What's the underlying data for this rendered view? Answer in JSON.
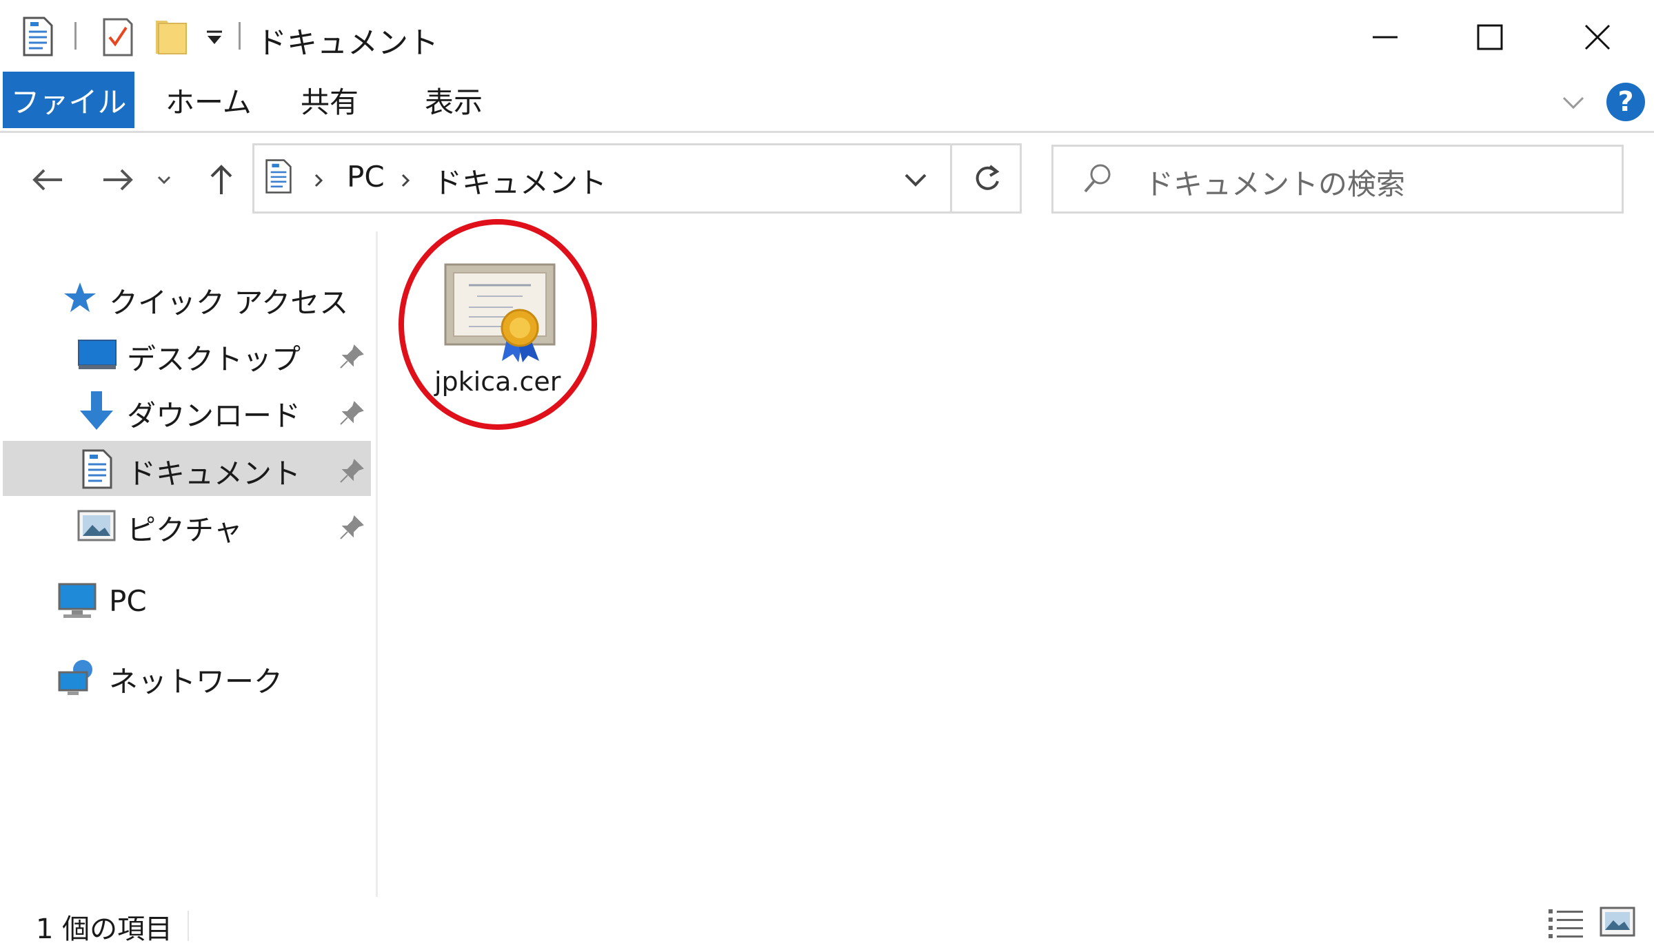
{
  "window": {
    "title": "ドキュメント"
  },
  "ribbon": {
    "tabs": [
      "ファイル",
      "ホーム",
      "共有",
      "表示"
    ],
    "help_label": "?"
  },
  "address": {
    "crumbs": [
      "PC",
      "ドキュメント"
    ],
    "search_placeholder": "ドキュメントの検索"
  },
  "sidebar": {
    "quick_access": "クイック アクセス",
    "items": [
      {
        "label": "デスクトップ",
        "icon": "desktop-icon",
        "pinned": true
      },
      {
        "label": "ダウンロード",
        "icon": "download-icon",
        "pinned": true
      },
      {
        "label": "ドキュメント",
        "icon": "documents-icon",
        "pinned": true,
        "selected": true
      },
      {
        "label": "ピクチャ",
        "icon": "pictures-icon",
        "pinned": true
      }
    ],
    "pc": "PC",
    "network": "ネットワーク"
  },
  "files": [
    {
      "name": "jpkica.cer",
      "icon": "certificate-icon",
      "highlighted": true
    }
  ],
  "status": {
    "item_count": "1 個の項目"
  },
  "colors": {
    "accent": "#1a6fc4",
    "highlight_ring": "#e0101b",
    "selected_bg": "#d9d9d9"
  }
}
